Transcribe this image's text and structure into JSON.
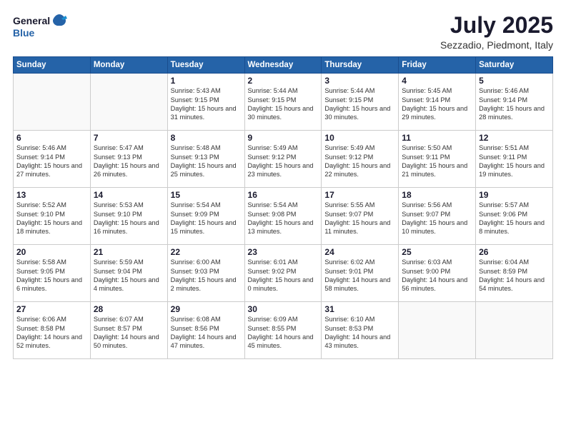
{
  "logo": {
    "general": "General",
    "blue": "Blue"
  },
  "title": "July 2025",
  "subtitle": "Sezzadio, Piedmont, Italy",
  "days_header": [
    "Sunday",
    "Monday",
    "Tuesday",
    "Wednesday",
    "Thursday",
    "Friday",
    "Saturday"
  ],
  "weeks": [
    [
      {
        "day": "",
        "info": ""
      },
      {
        "day": "",
        "info": ""
      },
      {
        "day": "1",
        "info": "Sunrise: 5:43 AM\nSunset: 9:15 PM\nDaylight: 15 hours\nand 31 minutes."
      },
      {
        "day": "2",
        "info": "Sunrise: 5:44 AM\nSunset: 9:15 PM\nDaylight: 15 hours\nand 30 minutes."
      },
      {
        "day": "3",
        "info": "Sunrise: 5:44 AM\nSunset: 9:15 PM\nDaylight: 15 hours\nand 30 minutes."
      },
      {
        "day": "4",
        "info": "Sunrise: 5:45 AM\nSunset: 9:14 PM\nDaylight: 15 hours\nand 29 minutes."
      },
      {
        "day": "5",
        "info": "Sunrise: 5:46 AM\nSunset: 9:14 PM\nDaylight: 15 hours\nand 28 minutes."
      }
    ],
    [
      {
        "day": "6",
        "info": "Sunrise: 5:46 AM\nSunset: 9:14 PM\nDaylight: 15 hours\nand 27 minutes."
      },
      {
        "day": "7",
        "info": "Sunrise: 5:47 AM\nSunset: 9:13 PM\nDaylight: 15 hours\nand 26 minutes."
      },
      {
        "day": "8",
        "info": "Sunrise: 5:48 AM\nSunset: 9:13 PM\nDaylight: 15 hours\nand 25 minutes."
      },
      {
        "day": "9",
        "info": "Sunrise: 5:49 AM\nSunset: 9:12 PM\nDaylight: 15 hours\nand 23 minutes."
      },
      {
        "day": "10",
        "info": "Sunrise: 5:49 AM\nSunset: 9:12 PM\nDaylight: 15 hours\nand 22 minutes."
      },
      {
        "day": "11",
        "info": "Sunrise: 5:50 AM\nSunset: 9:11 PM\nDaylight: 15 hours\nand 21 minutes."
      },
      {
        "day": "12",
        "info": "Sunrise: 5:51 AM\nSunset: 9:11 PM\nDaylight: 15 hours\nand 19 minutes."
      }
    ],
    [
      {
        "day": "13",
        "info": "Sunrise: 5:52 AM\nSunset: 9:10 PM\nDaylight: 15 hours\nand 18 minutes."
      },
      {
        "day": "14",
        "info": "Sunrise: 5:53 AM\nSunset: 9:10 PM\nDaylight: 15 hours\nand 16 minutes."
      },
      {
        "day": "15",
        "info": "Sunrise: 5:54 AM\nSunset: 9:09 PM\nDaylight: 15 hours\nand 15 minutes."
      },
      {
        "day": "16",
        "info": "Sunrise: 5:54 AM\nSunset: 9:08 PM\nDaylight: 15 hours\nand 13 minutes."
      },
      {
        "day": "17",
        "info": "Sunrise: 5:55 AM\nSunset: 9:07 PM\nDaylight: 15 hours\nand 11 minutes."
      },
      {
        "day": "18",
        "info": "Sunrise: 5:56 AM\nSunset: 9:07 PM\nDaylight: 15 hours\nand 10 minutes."
      },
      {
        "day": "19",
        "info": "Sunrise: 5:57 AM\nSunset: 9:06 PM\nDaylight: 15 hours\nand 8 minutes."
      }
    ],
    [
      {
        "day": "20",
        "info": "Sunrise: 5:58 AM\nSunset: 9:05 PM\nDaylight: 15 hours\nand 6 minutes."
      },
      {
        "day": "21",
        "info": "Sunrise: 5:59 AM\nSunset: 9:04 PM\nDaylight: 15 hours\nand 4 minutes."
      },
      {
        "day": "22",
        "info": "Sunrise: 6:00 AM\nSunset: 9:03 PM\nDaylight: 15 hours\nand 2 minutes."
      },
      {
        "day": "23",
        "info": "Sunrise: 6:01 AM\nSunset: 9:02 PM\nDaylight: 15 hours\nand 0 minutes."
      },
      {
        "day": "24",
        "info": "Sunrise: 6:02 AM\nSunset: 9:01 PM\nDaylight: 14 hours\nand 58 minutes."
      },
      {
        "day": "25",
        "info": "Sunrise: 6:03 AM\nSunset: 9:00 PM\nDaylight: 14 hours\nand 56 minutes."
      },
      {
        "day": "26",
        "info": "Sunrise: 6:04 AM\nSunset: 8:59 PM\nDaylight: 14 hours\nand 54 minutes."
      }
    ],
    [
      {
        "day": "27",
        "info": "Sunrise: 6:06 AM\nSunset: 8:58 PM\nDaylight: 14 hours\nand 52 minutes."
      },
      {
        "day": "28",
        "info": "Sunrise: 6:07 AM\nSunset: 8:57 PM\nDaylight: 14 hours\nand 50 minutes."
      },
      {
        "day": "29",
        "info": "Sunrise: 6:08 AM\nSunset: 8:56 PM\nDaylight: 14 hours\nand 47 minutes."
      },
      {
        "day": "30",
        "info": "Sunrise: 6:09 AM\nSunset: 8:55 PM\nDaylight: 14 hours\nand 45 minutes."
      },
      {
        "day": "31",
        "info": "Sunrise: 6:10 AM\nSunset: 8:53 PM\nDaylight: 14 hours\nand 43 minutes."
      },
      {
        "day": "",
        "info": ""
      },
      {
        "day": "",
        "info": ""
      }
    ]
  ]
}
